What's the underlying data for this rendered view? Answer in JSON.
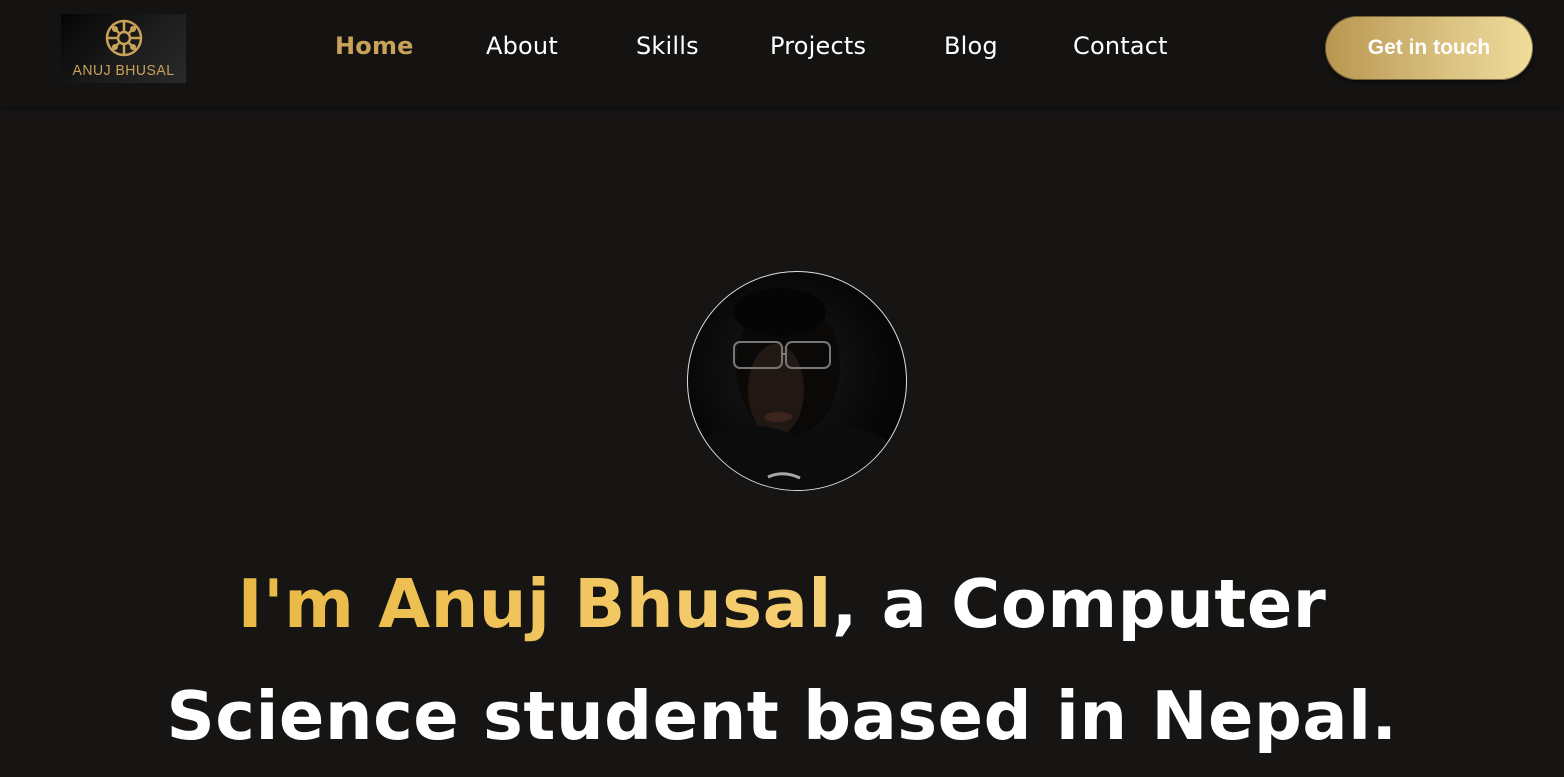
{
  "logo": {
    "text": "ANUJ BHUSAL"
  },
  "nav": {
    "items": [
      {
        "label": "Home",
        "active": true
      },
      {
        "label": "About",
        "active": false
      },
      {
        "label": "Skills",
        "active": false
      },
      {
        "label": "Projects",
        "active": false
      },
      {
        "label": "Blog",
        "active": false
      },
      {
        "label": "Contact",
        "active": false
      }
    ],
    "cta_label": "Get in touch"
  },
  "hero": {
    "name": "I'm Anuj Bhusal",
    "rest_line1": ", a Computer",
    "line2": "Science student based in Nepal."
  },
  "colors": {
    "background": "#161514",
    "accent_gold": "#c9a25a",
    "name_gradient_start": "#e9b944",
    "name_gradient_end": "#f7d074",
    "text": "#ffffff"
  }
}
